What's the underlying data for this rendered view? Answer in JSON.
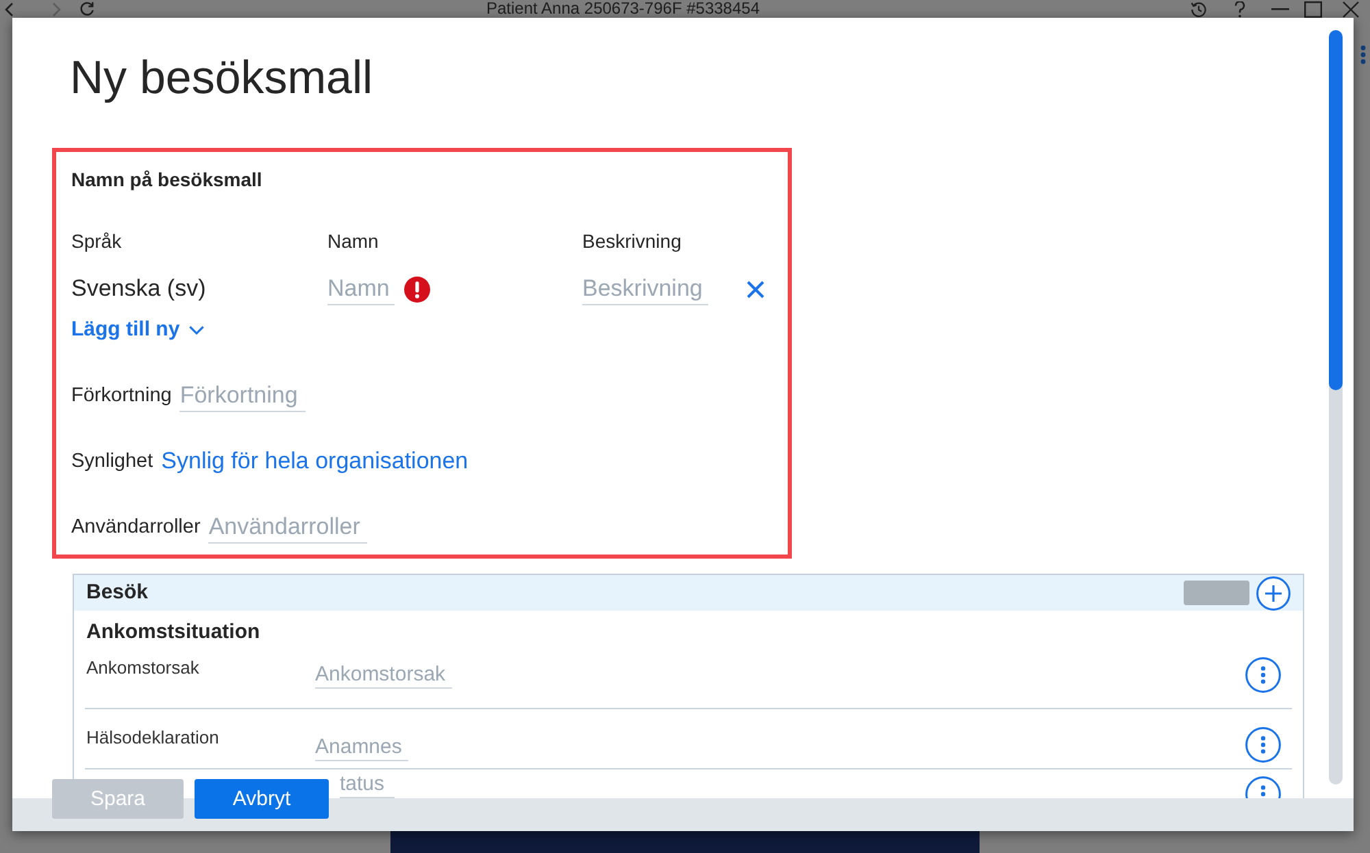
{
  "window": {
    "title": "Patient Anna 250673-796F #5338454"
  },
  "dialog": {
    "title": "Ny besöksmall",
    "name_section": {
      "highlighted": true,
      "heading": "Namn på besöksmall",
      "columns": [
        "Språk",
        "Namn",
        "Beskrivning"
      ],
      "translations": [
        {
          "language": "Svenska (sv)",
          "name": {
            "placeholder": "Namn",
            "error": true
          },
          "description": {
            "placeholder": "Beskrivning"
          }
        }
      ],
      "add_new": "Lägg till ny",
      "fields": [
        {
          "kind": "input",
          "label": "Förkortning",
          "placeholder": "Förkortning"
        },
        {
          "kind": "link",
          "label": "Synlighet",
          "value": "Synlig för hela organisationen"
        },
        {
          "kind": "input",
          "label": "Användarroller",
          "placeholder": "Användarroller"
        }
      ]
    },
    "panel": {
      "title": "Besök",
      "groups": [
        {
          "title": "Ankomstsituation",
          "rows": [
            {
              "label": "Ankomstorsak",
              "placeholder": "Ankomstorsak"
            },
            {
              "label": "Hälsodeklaration",
              "placeholder": "Anamnes"
            },
            {
              "placeholder": "tatus"
            }
          ]
        }
      ]
    },
    "buttons": [
      {
        "label": "Spara",
        "disabled": true
      },
      {
        "label": "Avbryt",
        "disabled": false
      }
    ]
  }
}
